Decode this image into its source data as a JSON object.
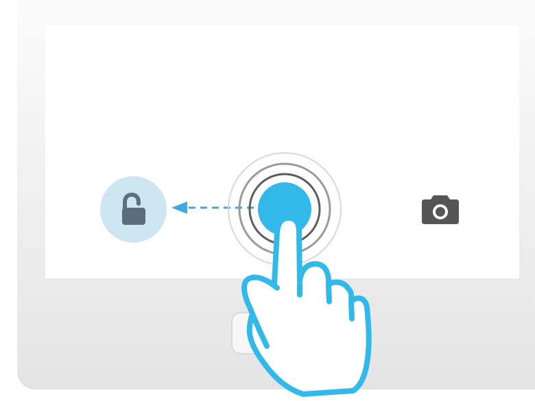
{
  "lockscreen": {
    "unlock_target": {
      "icon": "unlocked-padlock-icon",
      "background_color": "#cde6f2",
      "icon_color": "#5b6e7c"
    },
    "drag_handle": {
      "fill_color": "#32b9ea",
      "ring_color_inner": "#5c5c5c",
      "ring_color_middle": "#9a9a9a",
      "ring_color_outer": "#d8d8d8"
    },
    "swipe_direction": {
      "icon": "dashed-arrow-left-icon",
      "color": "#41a9dd"
    },
    "camera_shortcut": {
      "icon": "camera-icon",
      "color": "#555555"
    }
  },
  "gesture": {
    "icon": "hand-pointer-icon",
    "outline_color": "#32b9ea",
    "fill_color": "#ffffff"
  },
  "device": {
    "home_button_icon": "home-button-icon",
    "frame_color": "#eeeeee"
  }
}
